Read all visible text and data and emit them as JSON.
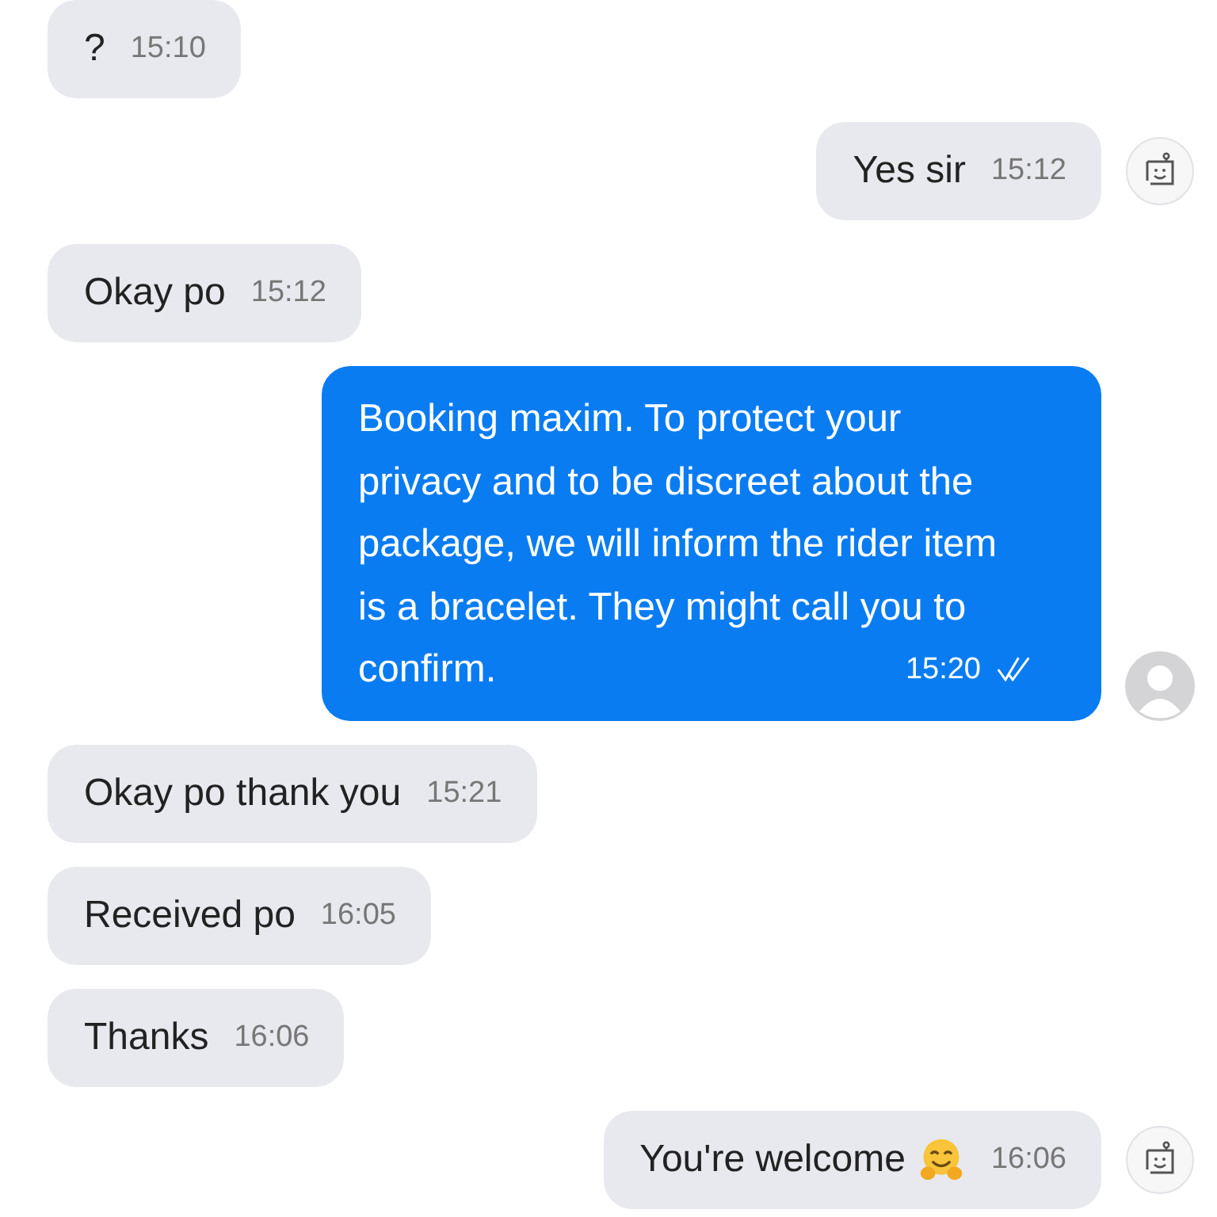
{
  "messages": [
    {
      "kind": "received",
      "text": "?",
      "time": "15:10"
    },
    {
      "kind": "sent_bot",
      "text": "Yes sir",
      "time": "15:12"
    },
    {
      "kind": "received",
      "text": "Okay po",
      "time": "15:12"
    },
    {
      "kind": "sent_agent",
      "text": "Booking maxim. To protect your privacy and to be discreet about the package, we will inform the rider item is a bracelet. They might call you to confirm.",
      "time": "15:20",
      "read": true
    },
    {
      "kind": "received",
      "text": "Okay po thank you",
      "time": "15:21"
    },
    {
      "kind": "received",
      "text": "Received po",
      "time": "16:05"
    },
    {
      "kind": "received",
      "text": "Thanks",
      "time": "16:06"
    },
    {
      "kind": "sent_bot",
      "text": "You're welcome",
      "emoji": true,
      "time": "16:06"
    }
  ]
}
